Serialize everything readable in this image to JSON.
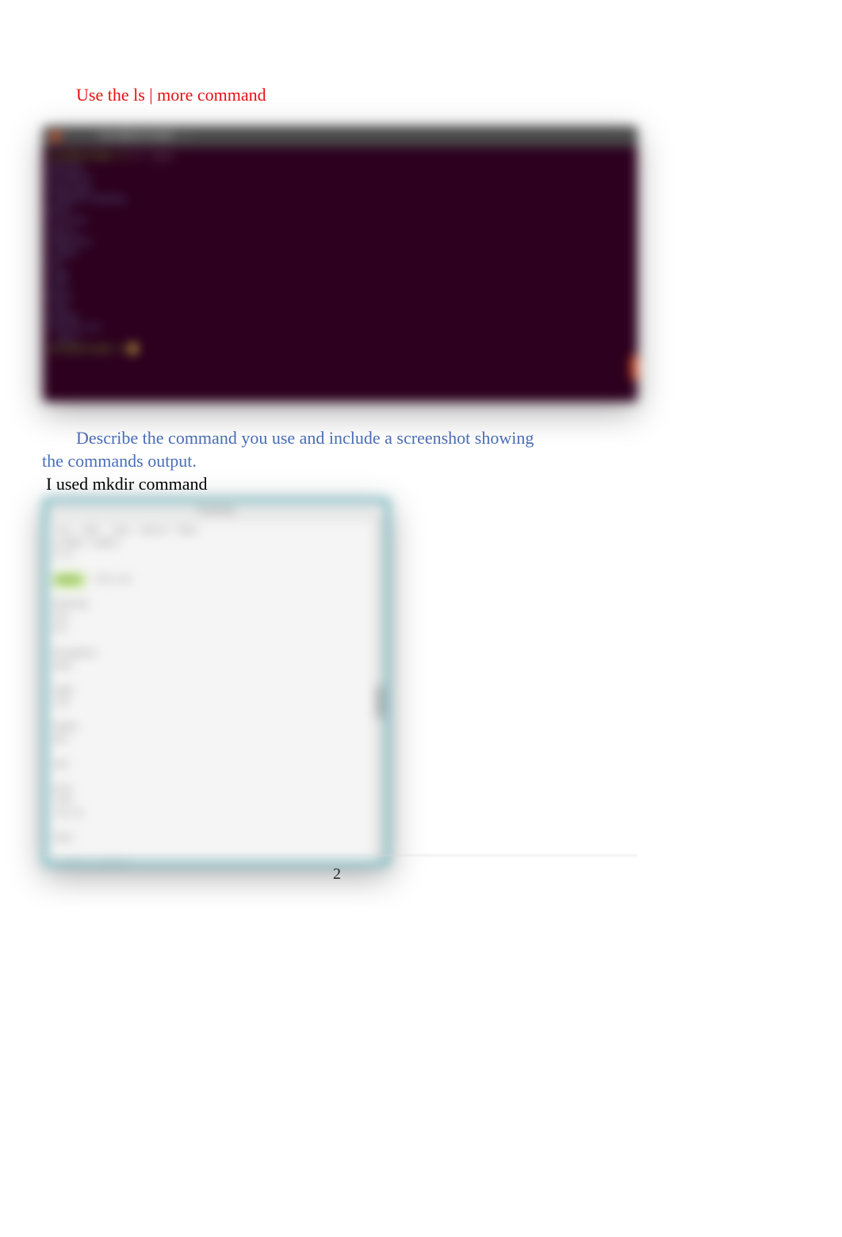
{
  "instructions": {
    "red_heading": "Use the ls | more command",
    "blue_line1": "Describe the command you use and include a screenshot showing",
    "blue_line2": "the commands output.",
    "answer": "I used mkdir command"
  },
  "page_number": "2",
  "terminal_dark": {
    "title": "user@hostname: ~",
    "lines": [
      "user@hostname:~$ ls | more",
      "Desktop",
      "Documents",
      "Downloads",
      "examples.desktop",
      "Music",
      "Pictures",
      "Public",
      "Templates",
      "Videos",
      "bin",
      "snap",
      "test",
      "Notes",
      "logs",
      "backup",
      "archive.tar",
      "--More--"
    ],
    "cursor_prefix": "user@hostname:~$ "
  },
  "terminal_light": {
    "title": "Terminal",
    "menu": "File  Edit  View  Search  Help",
    "lines": [
      "# mkdir newdir",
      "# ls",
      "",
      "newdir  file.txt",
      "",
      "Desktop",
      "bin",
      "etc",
      "",
      "Documents",
      "boot",
      "",
      "home",
      "lib",
      "",
      "media",
      "mnt",
      "",
      "opt",
      "",
      "proc",
      "root",
      "run.sh",
      "",
      "sbin",
      "",
      "examples.desktop",
      "",
      "",
      "srv",
      "sys",
      ""
    ],
    "highlights": {
      "3": "newdir",
      "30": "# "
    }
  }
}
